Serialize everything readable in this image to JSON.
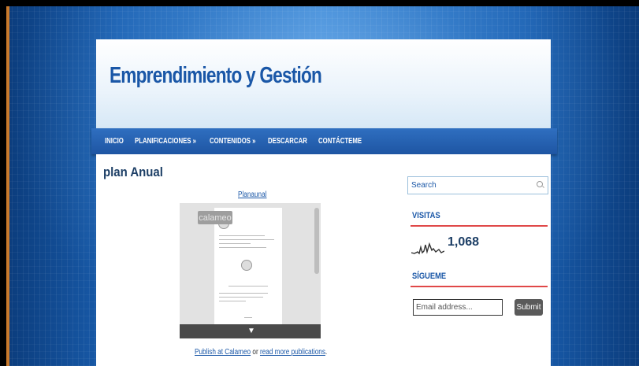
{
  "site": {
    "title": "Emprendimiento y Gestión"
  },
  "nav": {
    "items": [
      {
        "label": "INICIO"
      },
      {
        "label": "PLANIFICACIONES »"
      },
      {
        "label": "CONTENIDOS »"
      },
      {
        "label": "DESCARCAR"
      },
      {
        "label": "CONTÁCTEME"
      }
    ]
  },
  "post": {
    "title": "plan Anual",
    "doc_link": "Planaunal",
    "viewer_logo": "calameo",
    "viewer_arrow": "▼",
    "publish_link": "Publish at Calameo",
    "publish_or": " or ",
    "more_link": "read more publications",
    "publish_end": "."
  },
  "sidebar": {
    "search_placeholder": "Search",
    "visits_title": "VISITAS",
    "visits_count": "1,068",
    "follow_title": "SÍGUEME",
    "email_placeholder": "Email address...",
    "submit_label": "Submit"
  },
  "colors": {
    "accent": "#1a57a7",
    "nav": "#1e55a3",
    "rule": "#e04848"
  }
}
